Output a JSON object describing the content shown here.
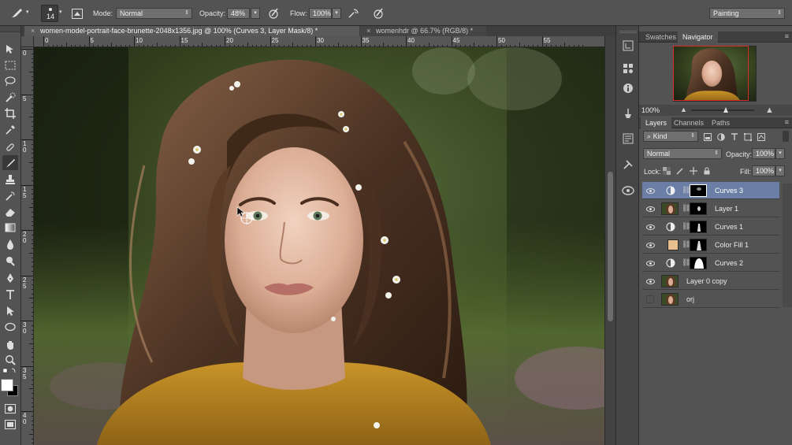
{
  "options_bar": {
    "brush_size": "14",
    "mode_label": "Mode:",
    "mode_value": "Normal",
    "opacity_label": "Opacity:",
    "opacity_value": "48%",
    "flow_label": "Flow:",
    "flow_value": "100%",
    "workspace": "Painting"
  },
  "doc_tabs": [
    {
      "title": "women-model-portrait-face-brunette-2048x1356.jpg @ 100% (Curves 3, Layer Mask/8) *",
      "active": true
    },
    {
      "title": "womenhdr @ 66.7% (RGB/8) *",
      "active": false
    }
  ],
  "ruler_h": [
    "0",
    "5",
    "10",
    "15",
    "20",
    "25",
    "30",
    "35",
    "40",
    "45",
    "50",
    "55"
  ],
  "ruler_v": [
    "0",
    "5",
    "1 0",
    "1 5",
    "2 0",
    "2 5",
    "3 0",
    "3 5",
    "4 0"
  ],
  "navigator": {
    "tabs": [
      "Swatches",
      "Navigator"
    ],
    "active_tab": "Navigator",
    "zoom": "100%"
  },
  "layers_panel": {
    "tabs": [
      "Layers",
      "Channels",
      "Paths"
    ],
    "active_tab": "Layers",
    "filter_kind": "Kind",
    "blend_mode": "Normal",
    "opacity_label": "Opacity:",
    "opacity_value": "100%",
    "lock_label": "Lock:",
    "fill_label": "Fill:",
    "fill_value": "100%",
    "layers": [
      {
        "name": "Curves 3",
        "type": "adjustment",
        "mask": "curves3",
        "selected": true,
        "visible": true
      },
      {
        "name": "Layer 1",
        "type": "pixel-masked",
        "mask": "layer1",
        "selected": false,
        "visible": true
      },
      {
        "name": "Curves 1",
        "type": "adjustment",
        "mask": "curves1",
        "selected": false,
        "visible": true
      },
      {
        "name": "Color Fill 1",
        "type": "fill",
        "mask": "colorfill",
        "selected": false,
        "visible": true
      },
      {
        "name": "Curves 2",
        "type": "adjustment",
        "mask": "curves2",
        "selected": false,
        "visible": true
      },
      {
        "name": "Layer 0 copy",
        "type": "pixel",
        "selected": false,
        "visible": true
      },
      {
        "name": "orj",
        "type": "pixel",
        "selected": false,
        "visible": false
      }
    ]
  },
  "colors": {
    "chrome": "#535353",
    "selected_layer": "#6b7fa6",
    "fill_swatch": "#e8c08f",
    "nav_box": "#d92b2b"
  }
}
